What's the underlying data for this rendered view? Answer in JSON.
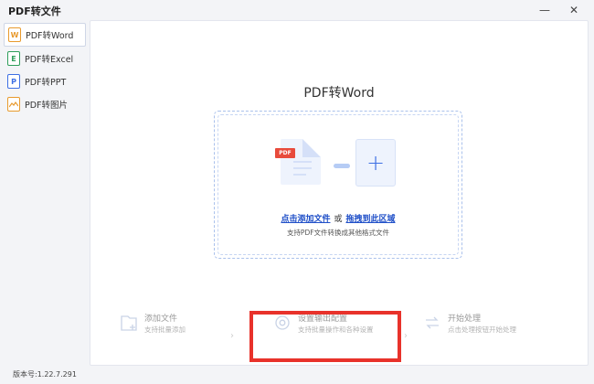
{
  "window": {
    "title": "PDF转文件",
    "minimize": "—",
    "close": "✕"
  },
  "sidebar": {
    "items": [
      {
        "label": "PDF转Word",
        "icon_letter": "W",
        "color": "#e89a2e",
        "active": true
      },
      {
        "label": "PDF转Excel",
        "icon_letter": "E",
        "color": "#2f9e5b",
        "active": false
      },
      {
        "label": "PDF转PPT",
        "icon_letter": "P",
        "color": "#3d6fe4",
        "active": false
      },
      {
        "label": "PDF转图片",
        "icon_letter": "",
        "color": "#e89a2e",
        "active": false
      }
    ]
  },
  "main": {
    "title": "PDF转Word",
    "dropzone": {
      "pdf_tag": "PDF",
      "plus": "+",
      "add_link": "点击添加文件",
      "or_text": "或",
      "drag_link": "拖拽到此区域",
      "sub_text": "支持PDF文件转换成其他格式文件"
    }
  },
  "steps": [
    {
      "title": "添加文件",
      "desc": "支持批量添加"
    },
    {
      "title": "设置输出配置",
      "desc": "支持批量操作和各种设置"
    },
    {
      "title": "开始处理",
      "desc": "点击处理按钮开始处理"
    }
  ],
  "step_arrow": "›",
  "version": "版本号:1.22.7.291",
  "colors": {
    "accent": "#3d6fe4",
    "link": "#1f4fc8",
    "highlight": "#e8322b",
    "pdf_tag": "#e84b3c"
  }
}
